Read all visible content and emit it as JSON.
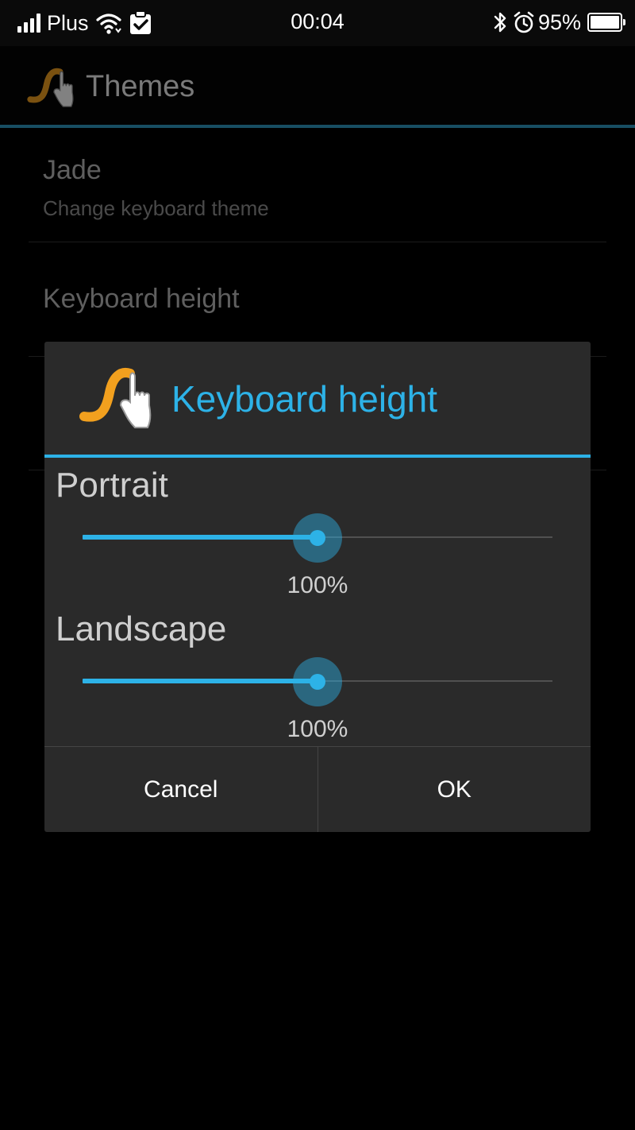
{
  "status_bar": {
    "carrier": "Plus",
    "time": "00:04",
    "battery": "95%"
  },
  "action_bar": {
    "title": "Themes",
    "logo_icon": "swipe-gesture-logo-icon"
  },
  "preferences": [
    {
      "title": "Jade",
      "summary": "Change keyboard theme"
    },
    {
      "title": "Keyboard height",
      "summary": ""
    }
  ],
  "dialog": {
    "title": "Keyboard height",
    "icon": "swipe-gesture-logo-icon",
    "portrait": {
      "label": "Portrait",
      "value_text": "100%",
      "fraction": 0.5
    },
    "landscape": {
      "label": "Landscape",
      "value_text": "100%",
      "fraction": 0.5
    },
    "cancel_label": "Cancel",
    "ok_label": "OK"
  },
  "colors": {
    "accent": "#2db2e7",
    "logo_orange": "#f2a01e",
    "dialog_bg": "#2a2a2a"
  }
}
